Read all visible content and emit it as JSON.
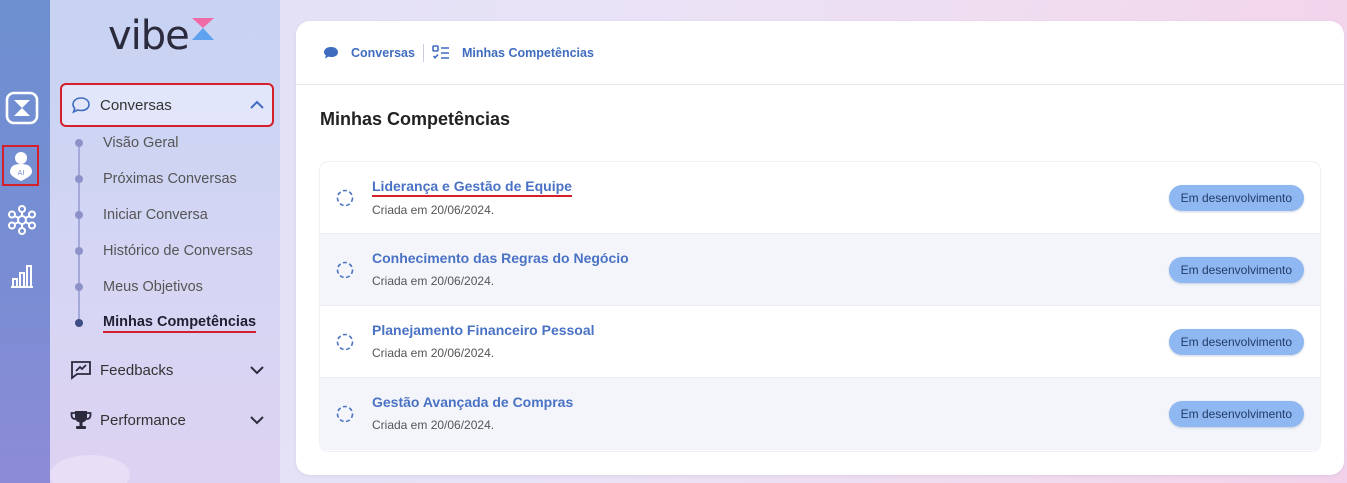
{
  "brand": {
    "logo_text": "vibe"
  },
  "rail": {
    "items": [
      {
        "icon": "hourglass-icon"
      },
      {
        "icon": "ai-user-icon",
        "active": true
      },
      {
        "icon": "network-icon"
      },
      {
        "icon": "bar-chart-icon"
      }
    ]
  },
  "sidebar": {
    "conversas": {
      "label": "Conversas",
      "icon": "chat-bubble-icon",
      "items": [
        {
          "label": "Visão Geral"
        },
        {
          "label": "Próximas Conversas"
        },
        {
          "label": "Iniciar Conversa"
        },
        {
          "label": "Histórico de Conversas"
        },
        {
          "label": "Meus Objetivos"
        },
        {
          "label": "Minhas Competências",
          "active": true
        }
      ]
    },
    "feedbacks": {
      "label": "Feedbacks",
      "icon": "feedback-icon"
    },
    "performance": {
      "label": "Performance",
      "icon": "trophy-icon"
    }
  },
  "breadcrumb": {
    "items": [
      {
        "label": "Conversas",
        "icon": "chat-bubble-icon"
      },
      {
        "label": "Minhas Competências",
        "icon": "checklist-icon"
      }
    ]
  },
  "main": {
    "title": "Minhas Competências",
    "competencies": [
      {
        "title": "Liderança e Gestão de Equipe",
        "created": "Criada em 20/06/2024.",
        "status": "Em desenvolvimento"
      },
      {
        "title": "Conhecimento das Regras do Negócio",
        "created": "Criada em 20/06/2024.",
        "status": "Em desenvolvimento"
      },
      {
        "title": "Planejamento Financeiro Pessoal",
        "created": "Criada em 20/06/2024.",
        "status": "Em desenvolvimento"
      },
      {
        "title": "Gestão Avançada de Compras",
        "created": "Criada em 20/06/2024.",
        "status": "Em desenvolvimento"
      }
    ]
  },
  "colors": {
    "accent": "#4a72c4",
    "badge": "#8fb8f2",
    "highlight": "#d5202b"
  }
}
